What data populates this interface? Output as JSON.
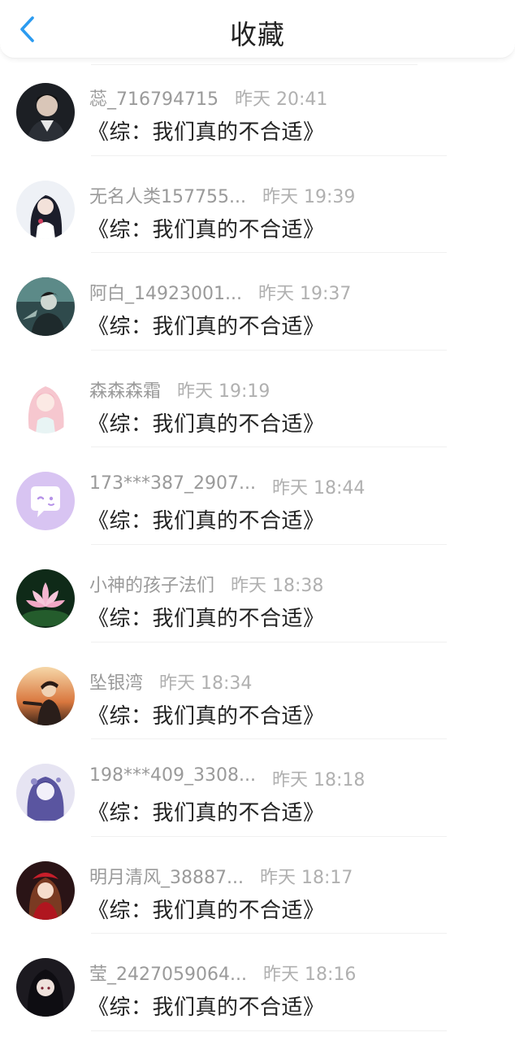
{
  "header": {
    "title": "收藏",
    "back_icon": "chevron-left-icon",
    "accent_color": "#2b9bf0"
  },
  "items": [
    {
      "name": "蕊_716794715",
      "time": "昨天 20:41",
      "work": "《综：我们真的不合适》",
      "avatar": "dark-portrait"
    },
    {
      "name": "无名人类157755...",
      "time": "昨天 19:39",
      "work": "《综：我们真的不合适》",
      "avatar": "anime-girl-dark-hair"
    },
    {
      "name": "阿白_14923001...",
      "time": "昨天 19:37",
      "work": "《综：我们真的不合适》",
      "avatar": "anime-boy-teal"
    },
    {
      "name": "森森森霜",
      "time": "昨天 19:19",
      "work": "《综：我们真的不合适》",
      "avatar": "anime-girl-pink"
    },
    {
      "name": "173***387_2907...",
      "time": "昨天 18:44",
      "work": "《综：我们真的不合适》",
      "avatar": "purple-chat-default"
    },
    {
      "name": "小神的孩子法们",
      "time": "昨天 18:38",
      "work": "《综：我们真的不合适》",
      "avatar": "lotus-flower"
    },
    {
      "name": "坠银湾",
      "time": "昨天 18:34",
      "work": "《综：我们真的不合适》",
      "avatar": "anime-boy-sunset"
    },
    {
      "name": "198***409_3308...",
      "time": "昨天 18:18",
      "work": "《综：我们真的不合适》",
      "avatar": "anime-girl-purple-sketch"
    },
    {
      "name": "明月清风_38887...",
      "time": "昨天 18:17",
      "work": "《综：我们真的不合适》",
      "avatar": "anime-girl-red"
    },
    {
      "name": "莹_2427059064...",
      "time": "昨天 18:16",
      "work": "《综：我们真的不合适》",
      "avatar": "anime-girl-black-hair"
    }
  ]
}
